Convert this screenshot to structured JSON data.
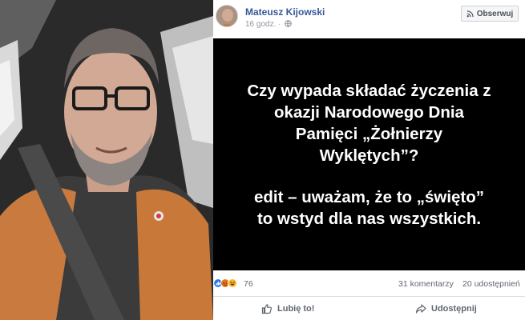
{
  "post": {
    "author": "Mateusz Kijowski",
    "time": "16 godz. ·",
    "follow_label": "Obserwuj",
    "image_text": {
      "question": "Czy wypada składać życzenia z\nokazji Narodowego Dnia\nPamięci „Żołnierzy\nWyklętych”?",
      "edit": "edit – uważam, że to „święto”\nto wstyd dla nas wszystkich."
    },
    "reactions": {
      "count": "76",
      "icons": [
        "like-icon",
        "angry-icon",
        "haha-icon"
      ],
      "colors": {
        "like": "#2078f4",
        "angry": "#e9710f",
        "haha": "#f7b125"
      }
    },
    "comments": "31 komentarzy",
    "shares": "20 udostępnień",
    "actions": {
      "like_label": "Lubię to!",
      "share_label": "Udostępnij"
    }
  },
  "colors": {
    "author_link": "#385898",
    "meta_text": "#90949c",
    "post_image_bg": "#000000"
  }
}
